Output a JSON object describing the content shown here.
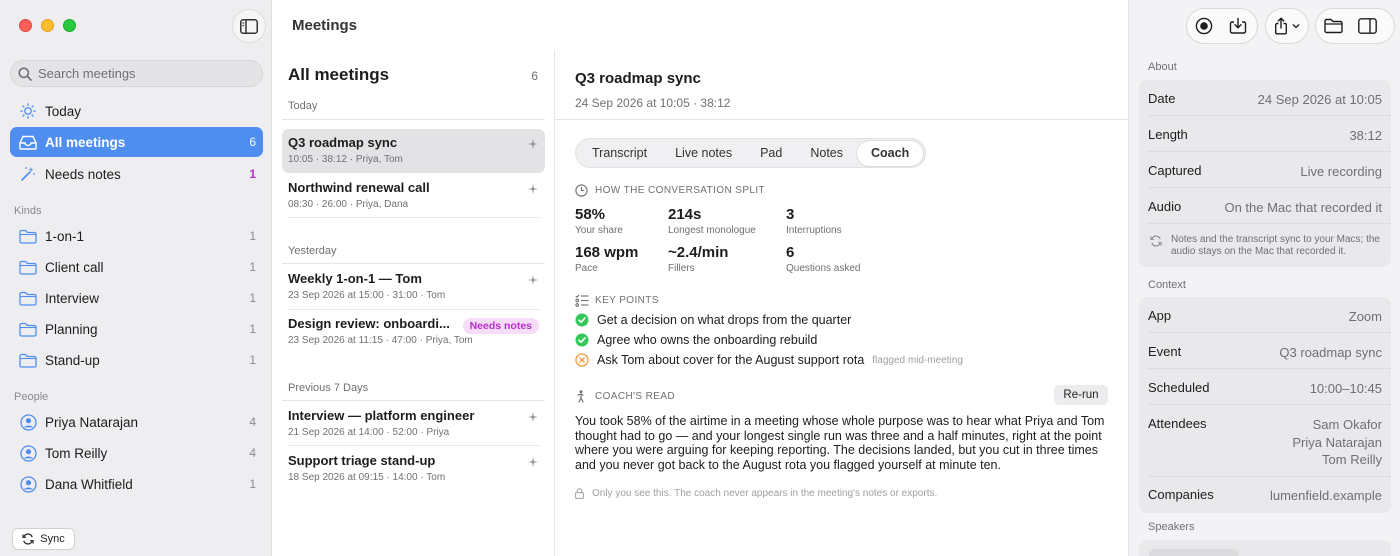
{
  "header": {
    "title": "Meetings"
  },
  "sidebar": {
    "search_placeholder": "Search meetings",
    "main_items": [
      {
        "label": "Today",
        "count": ""
      },
      {
        "label": "All meetings",
        "count": "6"
      },
      {
        "label": "Needs notes",
        "count": "1"
      }
    ],
    "kinds_label": "Kinds",
    "kinds": [
      {
        "label": "1-on-1",
        "count": "1"
      },
      {
        "label": "Client call",
        "count": "1"
      },
      {
        "label": "Interview",
        "count": "1"
      },
      {
        "label": "Planning",
        "count": "1"
      },
      {
        "label": "Stand-up",
        "count": "1"
      }
    ],
    "people_label": "People",
    "people": [
      {
        "label": "Priya Natarajan",
        "count": "4"
      },
      {
        "label": "Tom Reilly",
        "count": "4"
      },
      {
        "label": "Dana Whitfield",
        "count": "1"
      }
    ],
    "sync_label": "Sync",
    "accent": "#4f8ef0"
  },
  "list": {
    "heading": "All meetings",
    "count": "6",
    "groups": [
      {
        "label": "Today",
        "items": [
          {
            "title": "Q3 roadmap sync",
            "sub": "10:05 · 38:12 · Priya, Tom"
          },
          {
            "title": "Northwind renewal call",
            "sub": "08:30 · 26:00 · Priya, Dana"
          }
        ]
      },
      {
        "label": "Yesterday",
        "items": [
          {
            "title": "Weekly 1-on-1 — Tom",
            "sub": "23 Sep 2026 at 15:00 · 31:00 · Tom"
          },
          {
            "title": "Design review: onboardi...",
            "sub": "23 Sep 2026 at 11:15 · 47:00 · Priya, Tom",
            "badge": "Needs notes"
          }
        ]
      },
      {
        "label": "Previous 7 Days",
        "items": [
          {
            "title": "Interview — platform engineer",
            "sub": "21 Sep 2026 at 14:00 · 52:00 · Priya"
          },
          {
            "title": "Support triage stand-up",
            "sub": "18 Sep 2026 at 09:15 · 14:00 · Tom"
          }
        ]
      }
    ]
  },
  "detail": {
    "title": "Q3 roadmap sync",
    "subtitle": "24 Sep 2026 at 10:05 · 38:12",
    "tabs": [
      "Transcript",
      "Live notes",
      "Pad",
      "Notes",
      "Coach"
    ],
    "split_heading": "HOW THE CONVERSATION SPLIT",
    "stats": [
      {
        "value": "58%",
        "label": "Your share"
      },
      {
        "value": "214s",
        "label": "Longest monologue"
      },
      {
        "value": "3",
        "label": "Interruptions"
      },
      {
        "value": "168 wpm",
        "label": "Pace"
      },
      {
        "value": "~2.4/min",
        "label": "Fillers"
      },
      {
        "value": "6",
        "label": "Questions asked"
      }
    ],
    "key_points_heading": "KEY POINTS",
    "key_points": [
      {
        "text": "Get a decision on what drops from the quarter",
        "status": "done"
      },
      {
        "text": "Agree who owns the onboarding rebuild",
        "status": "done"
      },
      {
        "text": "Ask Tom about cover for the August support rota",
        "status": "missed",
        "note": "flagged mid-meeting"
      }
    ],
    "coach_heading": "COACH'S READ",
    "rerun_label": "Re-run",
    "coach_text": "You took 58% of the airtime in a meeting whose whole purpose was to hear what Priya and Tom thought had to go — and your longest single run was three and a half minutes, right at the point where you were arguing for keeping reporting. The decisions landed, but you cut in three times and you never got back to the August rota you flagged yourself at minute ten.",
    "private_note": "Only you see this. The coach never appears in the meeting's notes or exports."
  },
  "inspector": {
    "about_label": "About",
    "about": [
      {
        "key": "Date",
        "value": "24 Sep 2026 at 10:05"
      },
      {
        "key": "Length",
        "value": "38:12"
      },
      {
        "key": "Captured",
        "value": "Live recording"
      },
      {
        "key": "Audio",
        "value": "On the Mac that recorded it"
      }
    ],
    "sync_note": "Notes and the transcript sync to your Macs; the audio stays on the Mac that recorded it.",
    "context_label": "Context",
    "context": [
      {
        "key": "App",
        "value": "Zoom"
      },
      {
        "key": "Event",
        "value": "Q3 roadmap sync"
      },
      {
        "key": "Scheduled",
        "value": "10:00–10:45"
      },
      {
        "key": "Attendees",
        "value": "Sam Okafor\nPriya Natarajan\nTom Reilly"
      },
      {
        "key": "Companies",
        "value": "lumenfield.example"
      }
    ],
    "speakers_label": "Speakers"
  }
}
